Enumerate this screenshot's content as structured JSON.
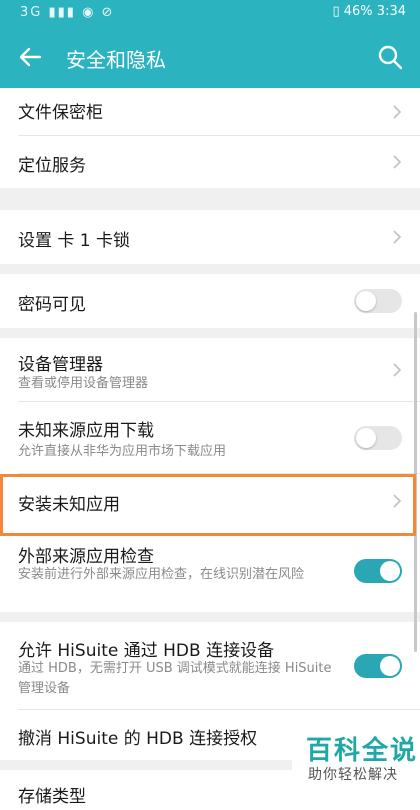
{
  "status_bar": {
    "left_icons": "3G ▮▮▮ ◉ ⊘",
    "battery": "46%",
    "time": "3:34"
  },
  "toolbar": {
    "title": "安全和隐私"
  },
  "items": {
    "file_safe": {
      "label": "文件保密柜"
    },
    "location_service": {
      "label": "定位服务"
    },
    "sim_lock": {
      "label": "设置 卡 1 卡锁"
    },
    "password_visible": {
      "label": "密码可见",
      "enabled": false
    },
    "device_admin": {
      "label": "设备管理器",
      "desc": "查看或停用设备管理器"
    },
    "unknown_source": {
      "label": "未知来源应用下载",
      "desc": "允许直接从非华为应用市场下载应用",
      "enabled": false
    },
    "install_unknown": {
      "label": "安装未知应用"
    },
    "external_check": {
      "label": "外部来源应用检查",
      "desc": "安装前进行外部来源应用检查，在线识别潜在风险",
      "enabled": true
    },
    "hisuite_hdb": {
      "label": "允许 HiSuite 通过 HDB 连接设备",
      "desc": "通过 HDB，无需打开 USB 调试模式就能连接 HiSuite 管理设备",
      "enabled": true
    },
    "revoke_hdb": {
      "label": "撤消 HiSuite 的 HDB 连接授权"
    },
    "storage_type": {
      "label": "存储类型"
    }
  },
  "watermark": {
    "title": "百科全说",
    "subtitle": "助你轻松解决"
  },
  "colors": {
    "accent": "#2bb3c0",
    "highlight": "#f08a3a",
    "toggle_on": "#2aa6b4"
  }
}
